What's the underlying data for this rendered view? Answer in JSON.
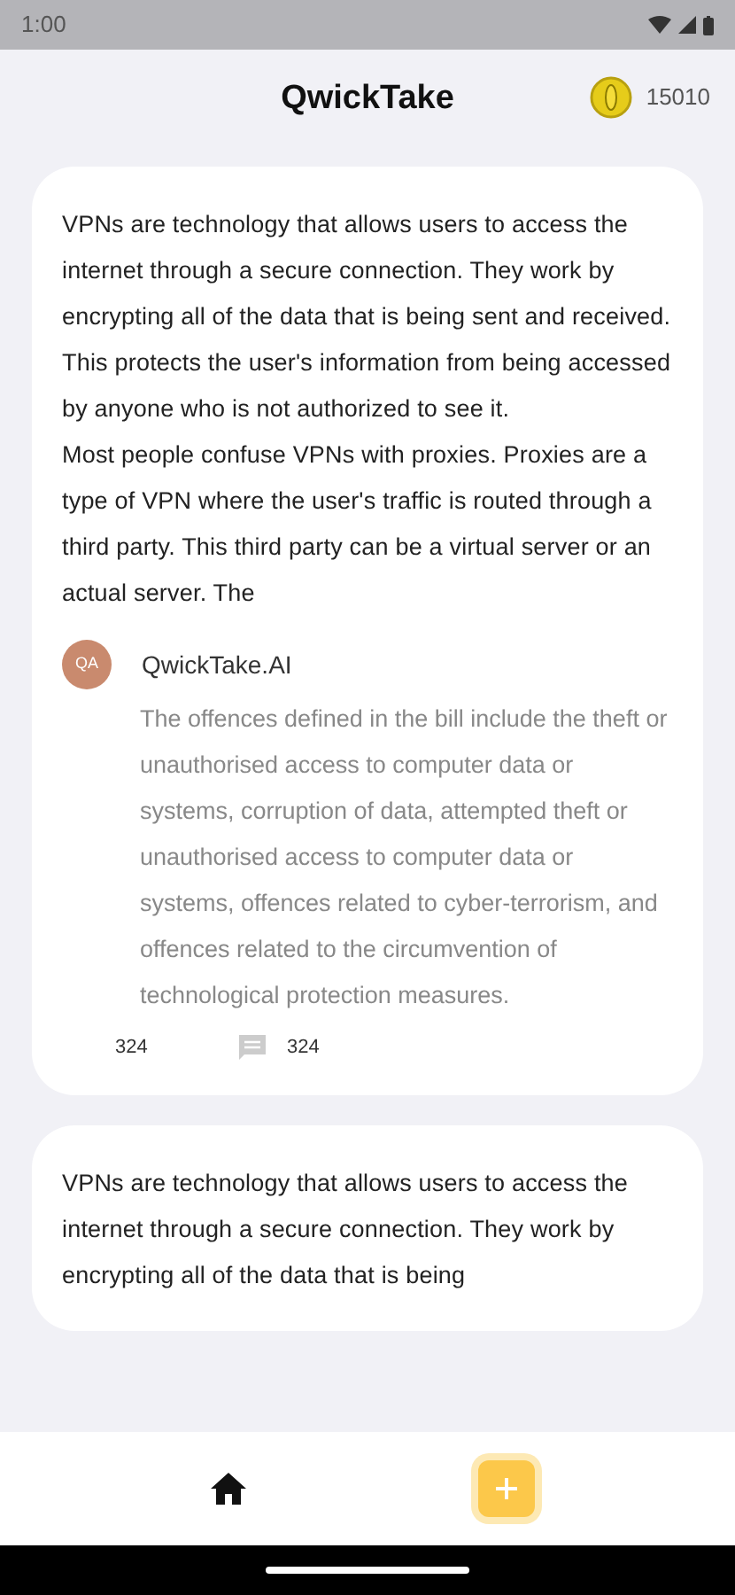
{
  "status_bar": {
    "time": "1:00"
  },
  "header": {
    "title": "QwickTake",
    "coins": "15010"
  },
  "posts": [
    {
      "paragraphs": [
        "VPNs are technology that allows users to access the internet through a secure connection. They work by encrypting all of the data that is being sent and received. This protects the user's information from being accessed by anyone who is not authorized to see it.",
        "Most people confuse VPNs with proxies. Proxies are a type of VPN where the user's traffic is routed through a third party. This third party can be a virtual server or an actual server. The"
      ],
      "answer": {
        "initials": "QA",
        "author": "QwickTake.AI",
        "text": "The offences defined in the bill include the theft or unauthorised access to computer data or systems, corruption of data, attempted theft or unauthorised access to computer data or systems, offences related to cyber-terrorism, and offences related to the circumvention of technological protection measures.",
        "likes": "324",
        "comments": "324"
      }
    },
    {
      "paragraphs": [
        "VPNs are technology that allows users to access the internet through a secure connection. They work by encrypting all of the data that is being"
      ]
    }
  ],
  "bottom_nav": [
    {
      "kind": "home"
    },
    {
      "kind": "add"
    }
  ]
}
